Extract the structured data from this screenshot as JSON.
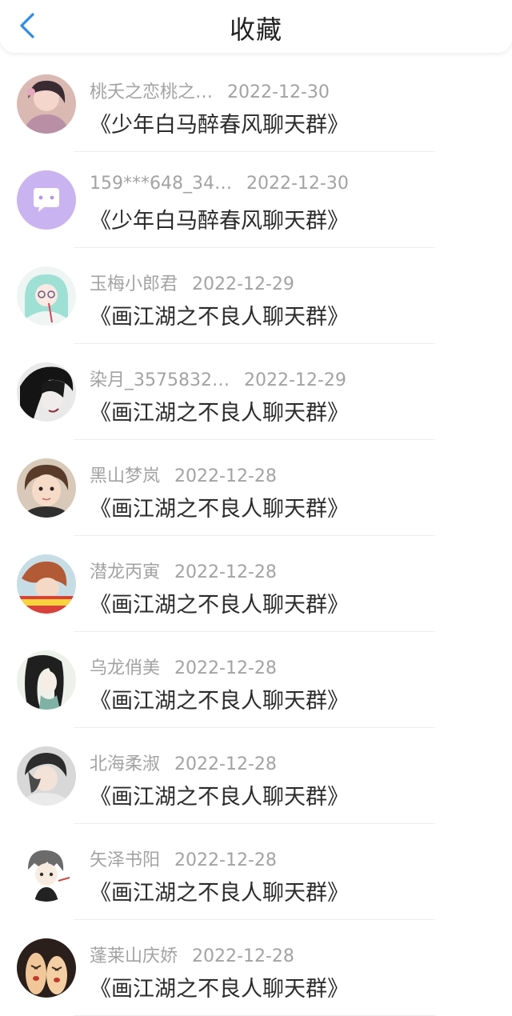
{
  "header": {
    "title": "收藏",
    "back_icon": "chevron-left-icon",
    "accent_color": "#2f8be6"
  },
  "favorites": [
    {
      "name": "桃夭之恋桃之…",
      "date": "2022-12-30",
      "group": "《少年白马醉春风聊天群》"
    },
    {
      "name": "159***648_34…",
      "date": "2022-12-30",
      "group": "《少年白马醉春风聊天群》"
    },
    {
      "name": "玉梅小郎君",
      "date": "2022-12-29",
      "group": "《画江湖之不良人聊天群》"
    },
    {
      "name": "染月_3575832…",
      "date": "2022-12-29",
      "group": "《画江湖之不良人聊天群》"
    },
    {
      "name": "黑山梦岚",
      "date": "2022-12-28",
      "group": "《画江湖之不良人聊天群》"
    },
    {
      "name": "潜龙丙寅",
      "date": "2022-12-28",
      "group": "《画江湖之不良人聊天群》"
    },
    {
      "name": "乌龙俏美",
      "date": "2022-12-28",
      "group": "《画江湖之不良人聊天群》"
    },
    {
      "name": "北海柔淑",
      "date": "2022-12-28",
      "group": "《画江湖之不良人聊天群》"
    },
    {
      "name": "矢泽书阳",
      "date": "2022-12-28",
      "group": "《画江湖之不良人聊天群》"
    },
    {
      "name": "蓬莱山庆娇",
      "date": "2022-12-28",
      "group": "《画江湖之不良人聊天群》"
    }
  ],
  "colors": {
    "meta_text": "#a3a3a3",
    "group_text": "#2b2b2b",
    "divider": "#eeeeee",
    "default_avatar_bg": "#c9b3f0"
  }
}
